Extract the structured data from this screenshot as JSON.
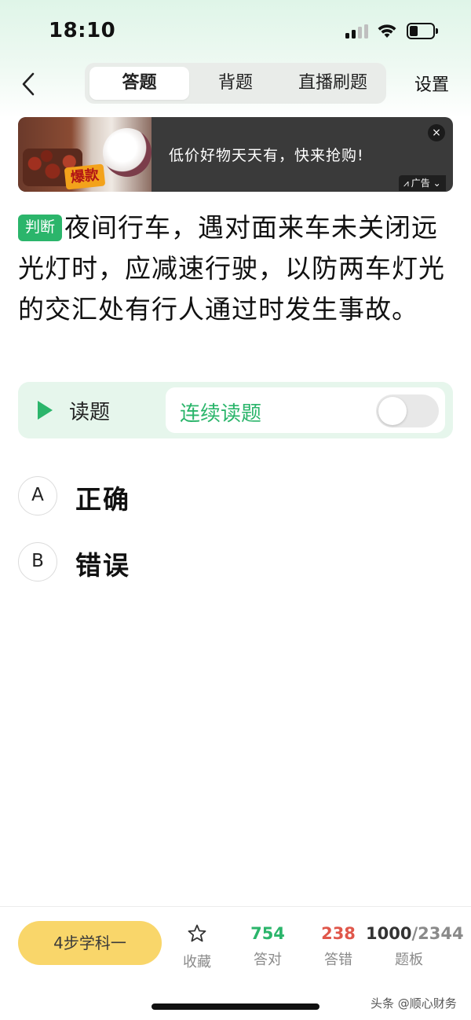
{
  "status_bar": {
    "time": "18:10",
    "battery_level": 0.35
  },
  "nav": {
    "tabs": [
      {
        "label": "答题",
        "active": true
      },
      {
        "label": "背题",
        "active": false
      },
      {
        "label": "直播刷题",
        "active": false
      }
    ],
    "settings_label": "设置"
  },
  "ad": {
    "sticker_text": "爆款",
    "text": "低价好物天天有，快来抢购!",
    "close_label": "×",
    "label": "广告"
  },
  "question": {
    "type_tag": "判断",
    "text": "夜间行车，遇对面来车未关闭远光灯时，应减速行驶，以防两车灯光的交汇处有行人通过时发生事故。"
  },
  "read_bar": {
    "read_label": "读题",
    "continuous_label": "连续读题",
    "continuous_enabled": false
  },
  "options": [
    {
      "letter": "A",
      "text": "正确"
    },
    {
      "letter": "B",
      "text": "错误"
    }
  ],
  "bottom_bar": {
    "subject_button": "4步学科一",
    "favorite_label": "收藏",
    "correct_count": "754",
    "correct_label": "答对",
    "wrong_count": "238",
    "wrong_label": "答错",
    "board_current": "1000",
    "board_total": "/2344",
    "board_label": "题板"
  },
  "watermark": "头条 @顺心财务",
  "colors": {
    "accent_green": "#2bb56b",
    "wrong_red": "#e0574b",
    "subject_yellow": "#f9d66a"
  }
}
